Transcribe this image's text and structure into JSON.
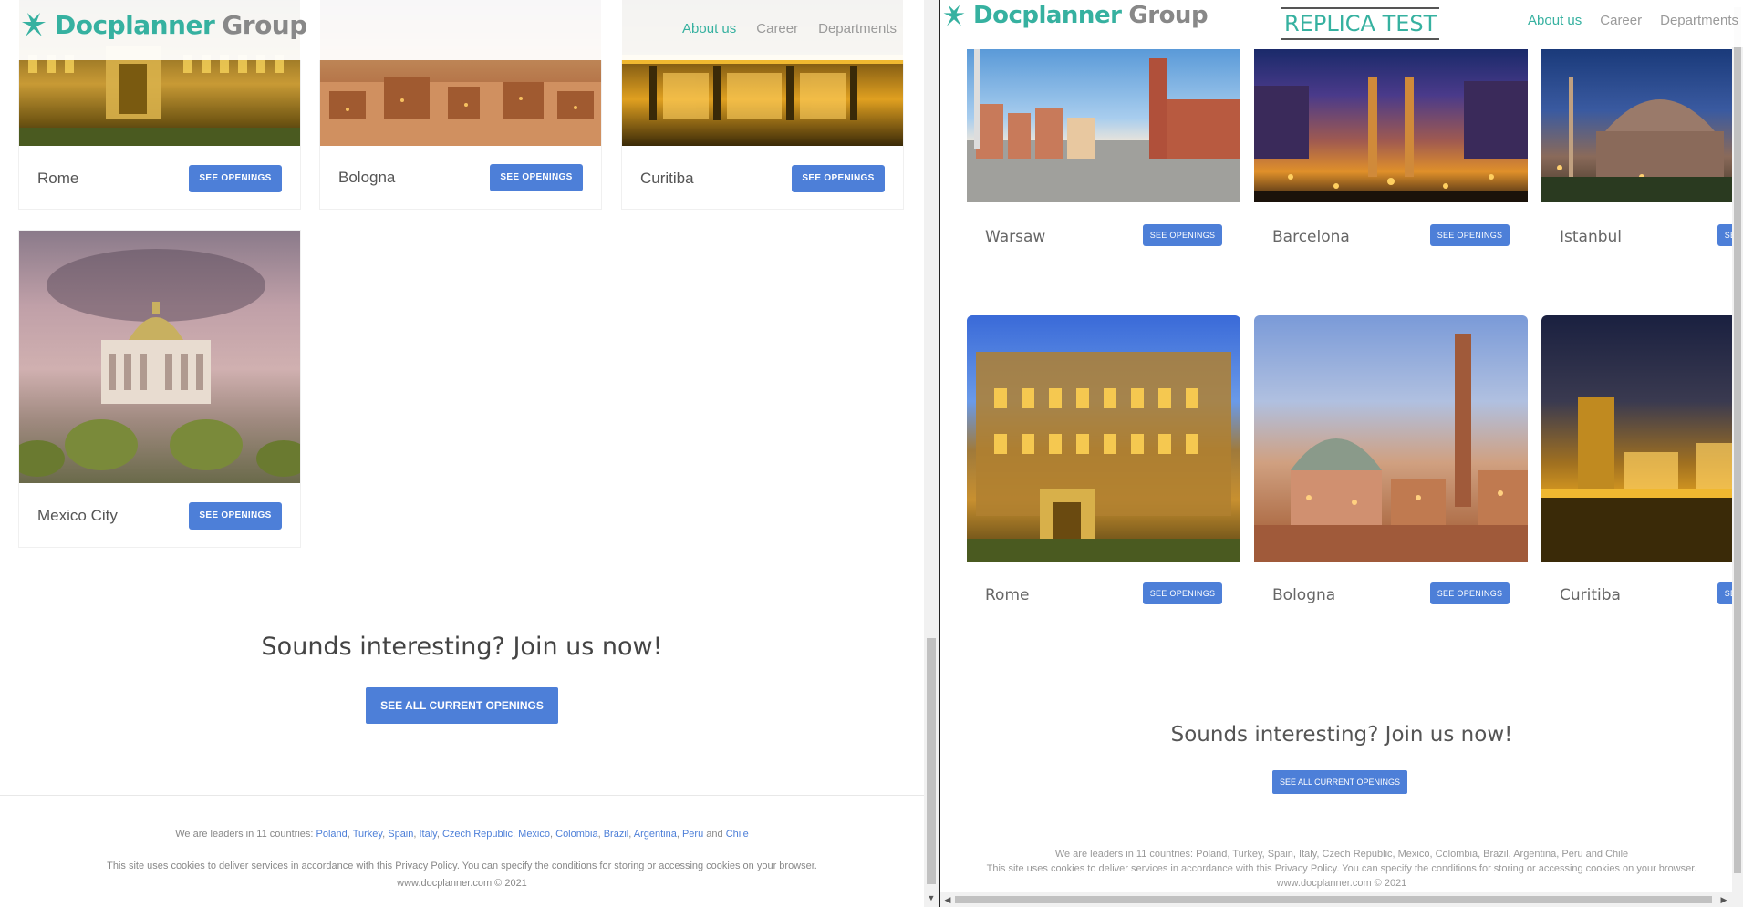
{
  "brand": {
    "name": "Docplanner",
    "suffix": "Group",
    "color": "#36b1a0"
  },
  "nav": [
    {
      "label": "About us",
      "active": true
    },
    {
      "label": "Career",
      "active": false
    },
    {
      "label": "Departments",
      "active": false
    }
  ],
  "replica_label": "REPLICA TEST",
  "button_label": "SEE OPENINGS",
  "button_label_right": "SEE OPENINGS",
  "left": {
    "row1": [
      "Rome",
      "Bologna",
      "Curitiba"
    ],
    "row2": [
      "Mexico City"
    ]
  },
  "right": {
    "row1": [
      "Warsaw",
      "Barcelona",
      "Istanbul"
    ],
    "row2": [
      "Rome",
      "Bologna",
      "Curitiba"
    ]
  },
  "cta": {
    "title": "Sounds interesting? Join us now!",
    "button": "SEE ALL CURRENT OPENINGS"
  },
  "footer": {
    "leaders_prefix": "We are leaders in 11 countries:",
    "countries": [
      "Poland",
      "Turkey",
      "Spain",
      "Italy",
      "Czech Republic",
      "Mexico",
      "Colombia",
      "Brazil",
      "Argentina",
      "Peru"
    ],
    "and": "and",
    "last_country": "Chile",
    "leaders_plain": "We are leaders in 11 countries: Poland, Turkey, Spain, Italy, Czech Republic, Mexico, Colombia, Brazil, Argentina, Peru and Chile",
    "cookies": "This site uses cookies to deliver services in accordance with this Privacy Policy. You can specify the conditions for storing or accessing cookies on your browser.",
    "copyright": "www.docplanner.com © 2021"
  },
  "colors": {
    "accent": "#4d7fd8",
    "brand": "#36b1a0",
    "nav_gray": "#9a9a9a"
  }
}
